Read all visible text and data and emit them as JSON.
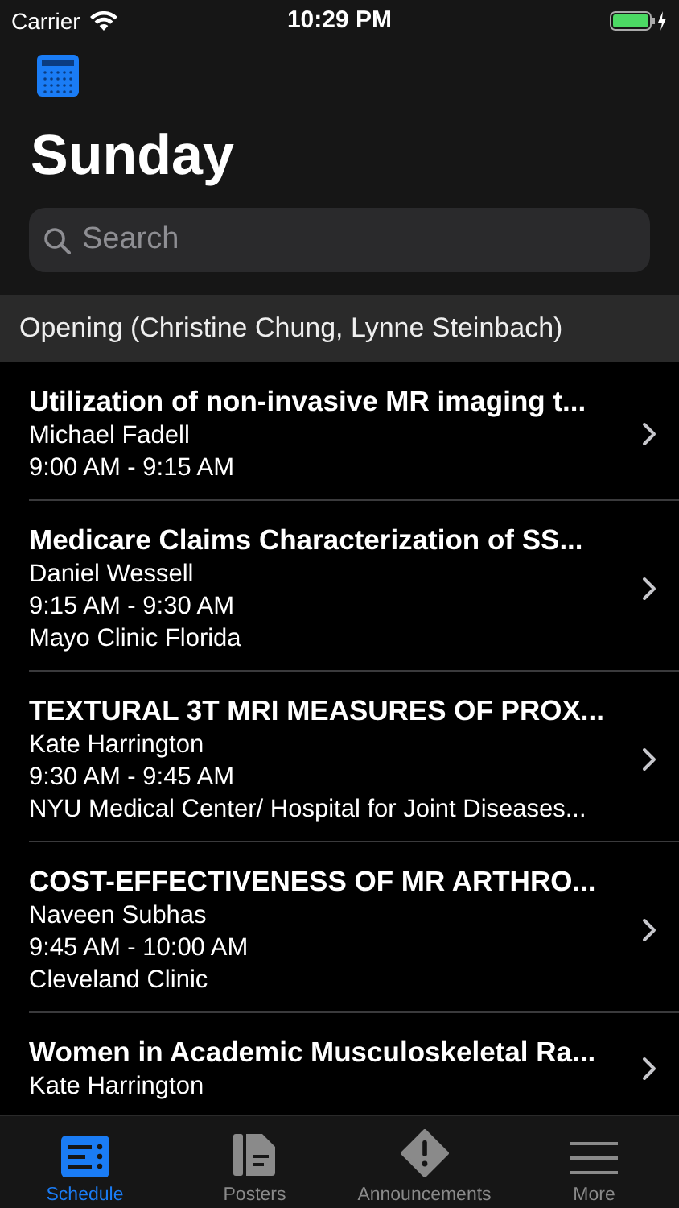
{
  "status_bar": {
    "carrier": "Carrier",
    "time": "10:29 PM"
  },
  "title": "Sunday",
  "search": {
    "placeholder": "Search"
  },
  "section": {
    "title": "Opening (Christine Chung, Lynne Steinbach)"
  },
  "sessions": [
    {
      "title": "Utilization of non-invasive MR imaging t...",
      "speaker": "Michael Fadell",
      "time": "9:00 AM - 9:15 AM"
    },
    {
      "title": "Medicare Claims Characterization of SS...",
      "speaker": "Daniel Wessell",
      "time": "9:15 AM - 9:30 AM",
      "location": "Mayo Clinic Florida"
    },
    {
      "title": "TEXTURAL 3T MRI MEASURES OF PROX...",
      "speaker": "Kate Harrington",
      "time": "9:30 AM - 9:45 AM",
      "location": "NYU Medical Center/ Hospital for Joint Diseases..."
    },
    {
      "title": "COST-EFFECTIVENESS OF MR ARTHRO...",
      "speaker": "Naveen Subhas",
      "time": "9:45 AM - 10:00 AM",
      "location": "Cleveland Clinic"
    },
    {
      "title": "Women in Academic Musculoskeletal Ra...",
      "speaker": "Kate Harrington"
    }
  ],
  "tabs": [
    {
      "kind": "schedule",
      "label": "Schedule",
      "selected": true
    },
    {
      "kind": "posters",
      "label": "Posters",
      "selected": false
    },
    {
      "kind": "announcements",
      "label": "Announcements",
      "selected": false
    },
    {
      "kind": "more",
      "label": "More",
      "selected": false
    }
  ]
}
